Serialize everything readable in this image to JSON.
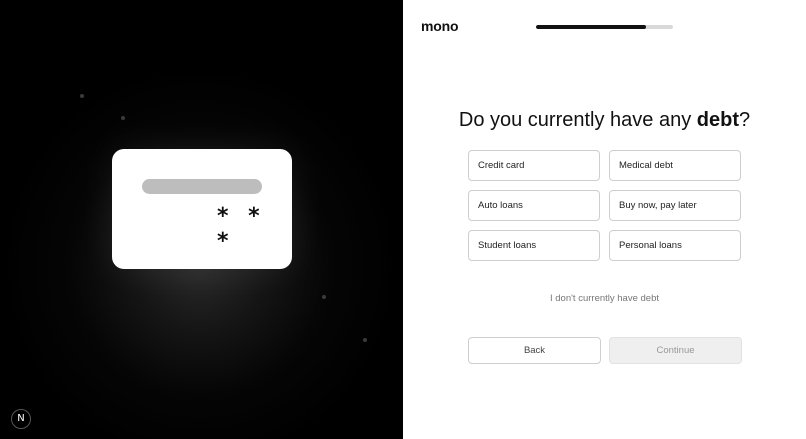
{
  "illustration": {
    "card_masked_number": "* * *"
  },
  "badge": {
    "label": "N"
  },
  "header": {
    "logo": "mono",
    "progress": 0.8
  },
  "question": {
    "prefix": "Do you currently have any ",
    "emphasis": "debt",
    "suffix": "?"
  },
  "options": [
    {
      "label": "Credit card"
    },
    {
      "label": "Medical debt"
    },
    {
      "label": "Auto loans"
    },
    {
      "label": "Buy now, pay later"
    },
    {
      "label": "Student loans"
    },
    {
      "label": "Personal loans"
    }
  ],
  "no_debt_link": "I don't currently have debt",
  "buttons": {
    "back": "Back",
    "continue": "Continue"
  }
}
